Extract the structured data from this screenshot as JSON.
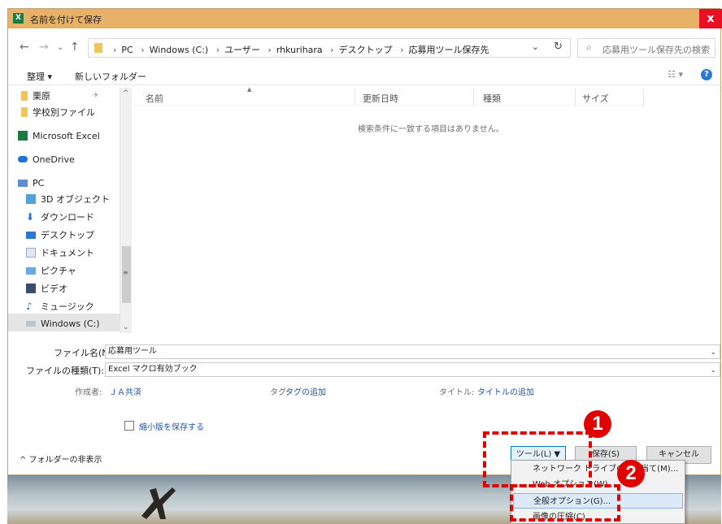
{
  "window": {
    "app_icon": "X",
    "title": "名前を付けて保存",
    "close": "x"
  },
  "nav": {
    "back": "←",
    "forward": "→",
    "recent": "⌄",
    "up": "↑",
    "breadcrumbs": [
      "PC",
      "Windows (C:)",
      "ユーザー",
      "rhkurihara",
      "デスクトップ",
      "応募用ツール保存先"
    ],
    "breadcrumb_sep": "›",
    "dropdown": "⌄",
    "refresh": "↻",
    "search_placeholder": "応募用ツール保存先の検索"
  },
  "toolbar": {
    "organize": "整理 ▾",
    "new_folder": "新しいフォルダー",
    "view": "☷ ▾",
    "help": "?"
  },
  "sidebar": {
    "items": [
      {
        "label": "栗原",
        "icon": "folder-icon",
        "pin": "✈"
      },
      {
        "label": "学校別ファイル",
        "icon": "folder-icon"
      },
      {
        "label": "Microsoft Excel",
        "icon": "excel-icon"
      },
      {
        "label": "OneDrive",
        "icon": "cloud-icon"
      },
      {
        "label": "PC",
        "icon": "pc-icon"
      },
      {
        "label": "3D オブジェクト",
        "icon": "3d-objects-icon"
      },
      {
        "label": "ダウンロード",
        "icon": "download-icon"
      },
      {
        "label": "デスクトップ",
        "icon": "desktop-icon"
      },
      {
        "label": "ドキュメント",
        "icon": "documents-icon"
      },
      {
        "label": "ピクチャ",
        "icon": "pictures-icon"
      },
      {
        "label": "ビデオ",
        "icon": "video-icon"
      },
      {
        "label": "ミュージック",
        "icon": "music-icon"
      },
      {
        "label": "Windows (C:)",
        "icon": "drive-icon"
      }
    ],
    "scroll_up": "^",
    "scroll_down": "⌄",
    "scroll_grip": "≡"
  },
  "file_list": {
    "columns": [
      "名前",
      "更新日時",
      "種類",
      "サイズ"
    ],
    "sort_indicator": "▲",
    "empty_message": "検索条件に一致する項目はありません。"
  },
  "form": {
    "filename_label": "ファイル名(N):",
    "filename_value": "応募用ツール",
    "filetype_label": "ファイルの種類(T):",
    "filetype_value": "Excel マクロ有効ブック",
    "chevron": "⌄",
    "author_label": "作成者:",
    "author_value": "ＪＡ共済",
    "tags_label": "タグ:",
    "tags_value": "タグの追加",
    "title_label": "タイトル:",
    "title_value": "タイトルの追加",
    "thumbnail_label": "縮小版を保存する"
  },
  "bottom": {
    "hide_folders": "^ フォルダーの非表示",
    "tools": "ツール(L)  ▼",
    "save": "保存(S)",
    "cancel": "キャンセル"
  },
  "tools_menu": {
    "items": [
      "ネットワーク ドライブの割り当て(M)...",
      "Web オプション(W)...",
      "全般オプション(G)...",
      "画像の圧縮(C)..."
    ]
  },
  "callouts": {
    "step1": "1",
    "step2": "2",
    "color": "#e00000"
  },
  "colors": {
    "title_bar": "#e8b168",
    "close_button": "#e81123",
    "link": "#1f56a8",
    "highlight": "#dbe9f8"
  }
}
